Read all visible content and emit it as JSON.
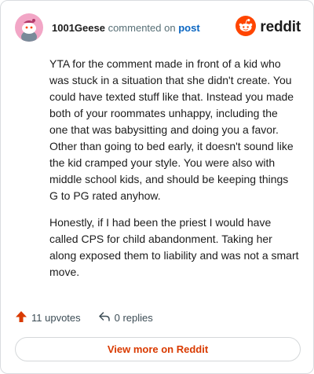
{
  "header": {
    "author": "1001Geese",
    "action_text": "commented on",
    "post_link": "post",
    "brand_name": "reddit"
  },
  "icons": {
    "avatar": "snoo-avatar-icon",
    "brand": "reddit-logo-icon",
    "upvote": "upvote-arrow-icon",
    "reply": "reply-arrow-icon"
  },
  "colors": {
    "brand_orange": "#ff4500",
    "link_blue": "#0a66c2",
    "view_more_text": "#d93a00",
    "avatar_bg": "#f2a6c6"
  },
  "comment": {
    "paragraphs": [
      "YTA for the comment made in front of a kid who was stuck in a situation that she didn't create. You could have texted stuff like that. Instead you made both of your roommates unhappy, including the one that was babysitting and doing you a favor. Other than going to bed early, it doesn't sound like the kid cramped your style. You were also with middle school kids, and should be keeping things G to PG rated anyhow.",
      "Honestly, if I had been the priest I would have called CPS for child abandonment. Taking her along exposed them to liability and was not a smart move."
    ]
  },
  "footer": {
    "upvotes": "11 upvotes",
    "replies": "0 replies",
    "view_more": "View more on Reddit"
  }
}
